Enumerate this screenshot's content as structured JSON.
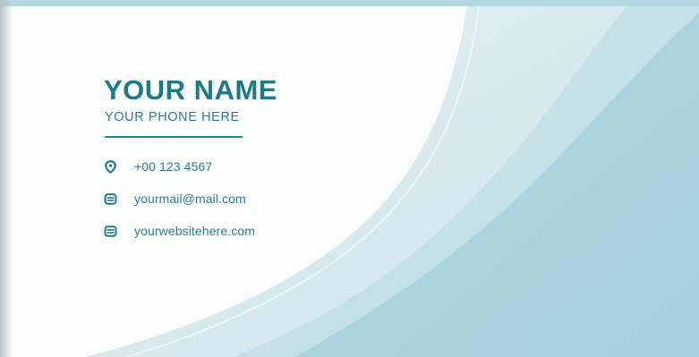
{
  "card": {
    "name": "YOUR NAME",
    "subtitle": "YOUR PHONE HERE",
    "contacts": [
      {
        "icon": "location-pin-icon",
        "text": "+00 123 4567"
      },
      {
        "icon": "email-icon",
        "text": "yourmail@mail.com"
      },
      {
        "icon": "website-icon",
        "text": "yourwebsitehere.com"
      }
    ]
  },
  "colors": {
    "accent": "#1c7c83",
    "text": "#2f7f86",
    "wave_light": "#cfe5eb",
    "wave_mid": "#b9dbe4",
    "wave_dark": "#a9d3de",
    "card_bg": "#fbfcfc"
  }
}
